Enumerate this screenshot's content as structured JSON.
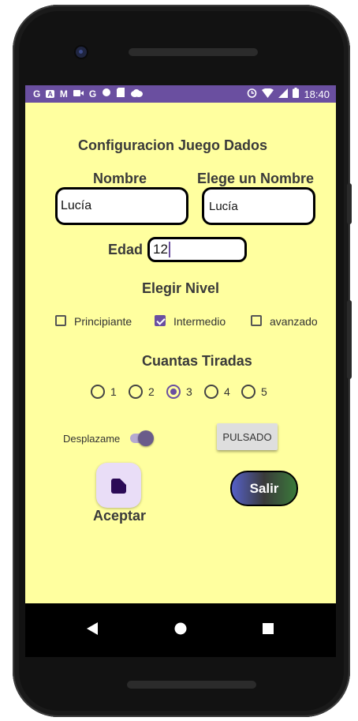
{
  "status_bar": {
    "left_icons": [
      "G",
      "A",
      "M",
      "video-icon",
      "G",
      "circle-icon",
      "sd-icon",
      "cloud-icon"
    ],
    "time": "18:40",
    "color": "#6a4fa0"
  },
  "app": {
    "background": "#ffff9f",
    "title": "Configuracion Juego Dados",
    "nombre_label": "Nombre",
    "elege_label": "Elege un Nombre",
    "nombre_value": "Lucía",
    "elege_value": "Lucía",
    "edad_label": "Edad",
    "edad_value": "12",
    "nivel_label": "Elegir Nivel",
    "levels": [
      {
        "label": "Principiante",
        "checked": false
      },
      {
        "label": "Intermedio",
        "checked": true
      },
      {
        "label": "avanzado",
        "checked": false
      }
    ],
    "tiradas_label": "Cuantas Tiradas",
    "tiradas": [
      {
        "label": "1",
        "selected": false
      },
      {
        "label": "2",
        "selected": false
      },
      {
        "label": "3",
        "selected": true
      },
      {
        "label": "4",
        "selected": false
      },
      {
        "label": "5",
        "selected": false
      }
    ],
    "switch_label": "Desplazame",
    "switch_on": true,
    "pulsado_label": "PULSADO",
    "aceptar_label": "Aceptar",
    "salir_label": "Salir",
    "accent": "#6a4fa0"
  },
  "nav": {
    "back": "back-icon",
    "home": "home-icon",
    "recents": "recents-icon"
  }
}
